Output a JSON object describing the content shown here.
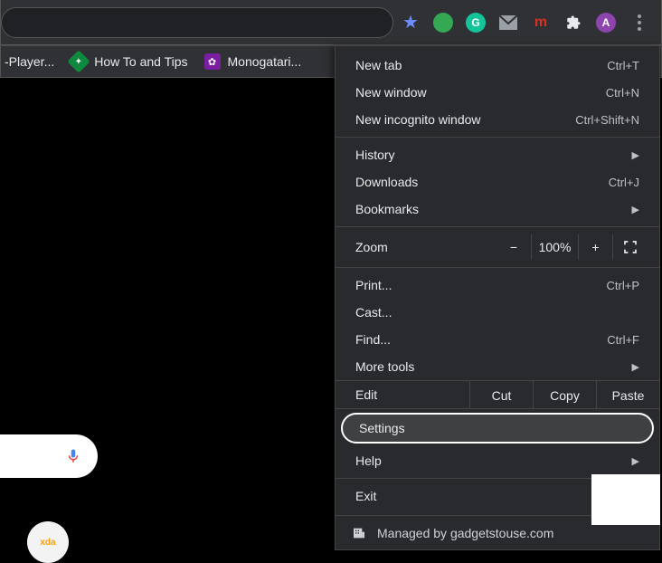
{
  "toolbar": {
    "star": "★",
    "profile_letter": "A",
    "ext_m": "m"
  },
  "bookmarks": [
    {
      "label": "-Player..."
    },
    {
      "label": "How To and Tips"
    },
    {
      "label": "Monogatari..."
    }
  ],
  "menu": {
    "new_tab": {
      "label": "New tab",
      "shortcut": "Ctrl+T"
    },
    "new_window": {
      "label": "New window",
      "shortcut": "Ctrl+N"
    },
    "new_incognito": {
      "label": "New incognito window",
      "shortcut": "Ctrl+Shift+N"
    },
    "history": {
      "label": "History"
    },
    "downloads": {
      "label": "Downloads",
      "shortcut": "Ctrl+J"
    },
    "bookmarks": {
      "label": "Bookmarks"
    },
    "zoom": {
      "label": "Zoom",
      "value": "100%"
    },
    "print": {
      "label": "Print...",
      "shortcut": "Ctrl+P"
    },
    "cast": {
      "label": "Cast..."
    },
    "find": {
      "label": "Find...",
      "shortcut": "Ctrl+F"
    },
    "more_tools": {
      "label": "More tools"
    },
    "edit": {
      "label": "Edit",
      "cut": "Cut",
      "copy": "Copy",
      "paste": "Paste"
    },
    "settings": {
      "label": "Settings"
    },
    "help": {
      "label": "Help"
    },
    "exit": {
      "label": "Exit"
    },
    "managed": {
      "label": "Managed by gadgetstouse.com"
    }
  },
  "avatar_label": "xda"
}
